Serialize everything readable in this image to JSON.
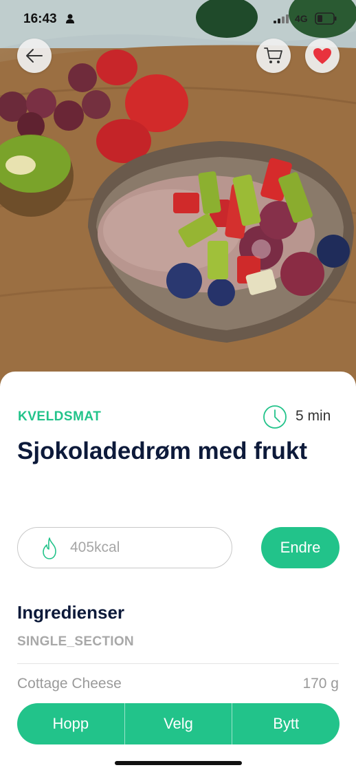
{
  "status_bar": {
    "time": "16:43",
    "network": "4G"
  },
  "header_actions": {
    "back_icon": "arrow-left-icon",
    "cart_icon": "cart-icon",
    "favorite_icon": "heart-icon",
    "favorite_color": "#e8323d"
  },
  "recipe": {
    "category": "KVELDSMAT",
    "prep_time": "5 min",
    "title": "Sjokoladedrøm med frukt",
    "calories": "405kcal",
    "edit_label": "Endre"
  },
  "ingredients": {
    "heading": "Ingredienser",
    "section_name": "SINGLE_SECTION",
    "items": [
      {
        "name": "Cottage Cheese",
        "amount": "170 g"
      }
    ]
  },
  "actions": {
    "skip_label": "Hopp",
    "choose_label": "Velg",
    "swap_label": "Bytt"
  },
  "colors": {
    "accent": "#22c38a",
    "title": "#0d1a3a"
  }
}
